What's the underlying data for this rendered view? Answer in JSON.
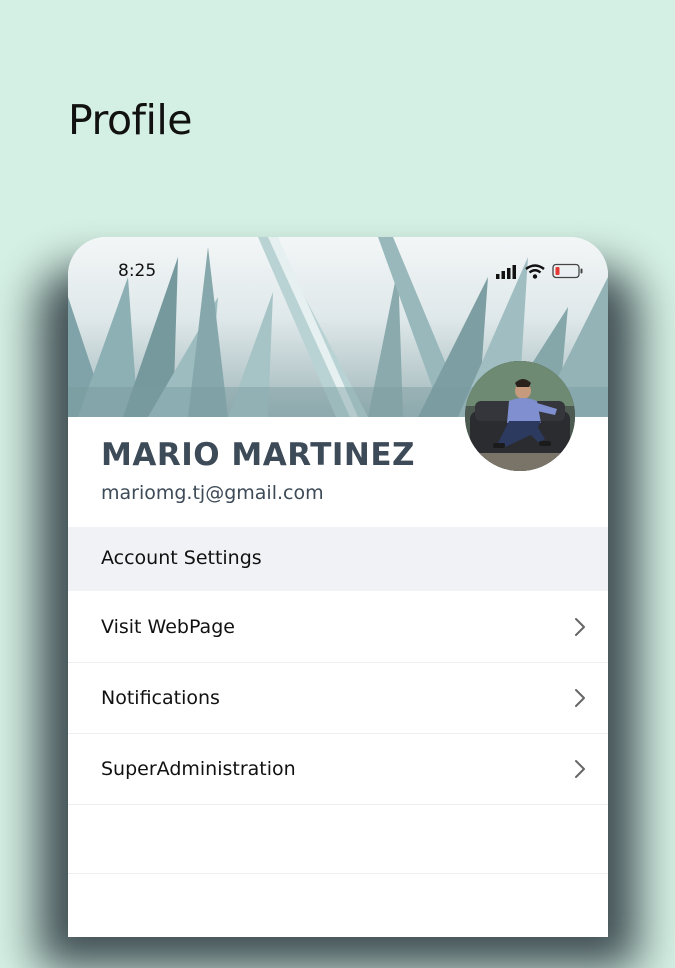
{
  "page": {
    "title": "Profile"
  },
  "status_bar": {
    "time": "8:25",
    "icons": [
      "signal-icon",
      "wifi-icon",
      "battery-low-icon"
    ]
  },
  "profile": {
    "name": "MARIO MARTINEZ",
    "email": "mariomg.tj@gmail.com"
  },
  "account_settings": {
    "header": "Account Settings",
    "items": [
      {
        "label": "Visit WebPage",
        "icon": "chevron-right-icon"
      },
      {
        "label": "Notifications",
        "icon": "chevron-right-icon"
      },
      {
        "label": "SuperAdministration",
        "icon": "chevron-right-icon"
      }
    ]
  },
  "colors": {
    "background": "#d4efe3",
    "name_text": "#3d4a57",
    "section_header_bg": "#f0f2f5",
    "battery_low": "#e53935"
  }
}
